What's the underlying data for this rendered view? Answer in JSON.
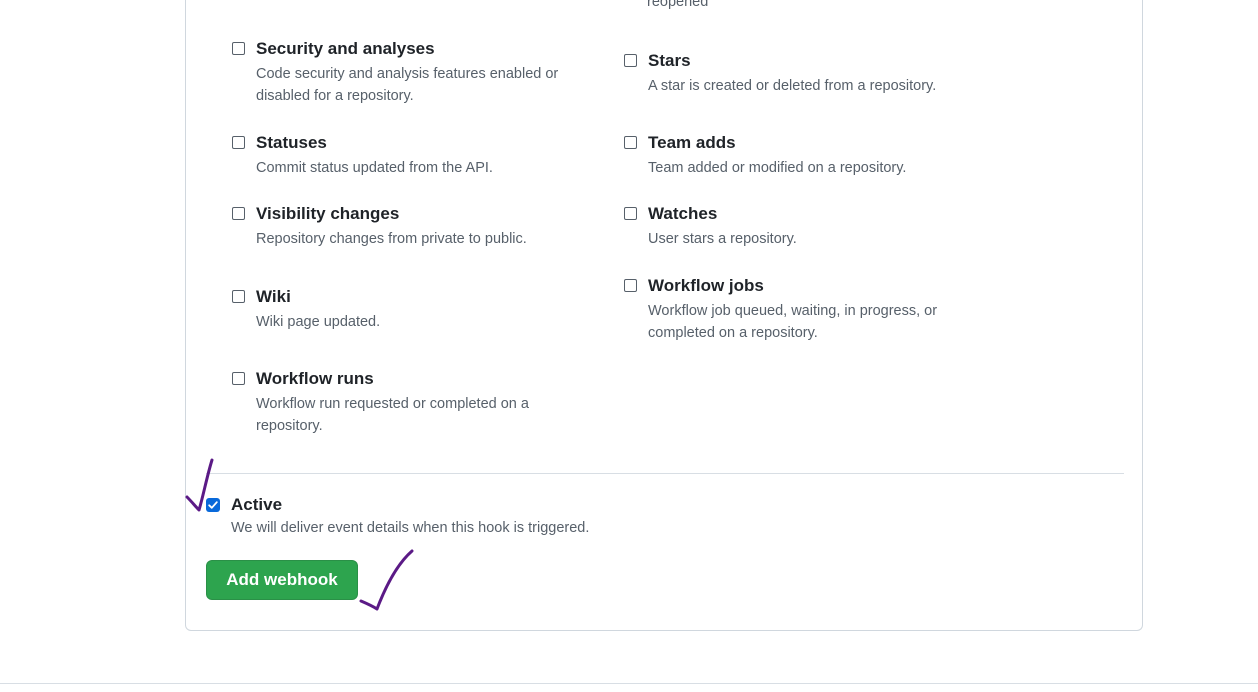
{
  "top_fragment": "reopened",
  "events_left": [
    {
      "title": "Security and analyses",
      "desc": "Code security and analysis features enabled or disabled for a repository.",
      "checked": false
    },
    {
      "title": "Statuses",
      "desc": "Commit status updated from the API.",
      "checked": false
    },
    {
      "title": "Visibility changes",
      "desc": "Repository changes from private to public.",
      "checked": false
    },
    {
      "title": "Wiki",
      "desc": "Wiki page updated.",
      "checked": false
    },
    {
      "title": "Workflow runs",
      "desc": "Workflow run requested or completed on a repository.",
      "checked": false
    }
  ],
  "events_right": [
    {
      "title": "Stars",
      "desc": "A star is created or deleted from a repository.",
      "checked": false
    },
    {
      "title": "Team adds",
      "desc": "Team added or modified on a repository.",
      "checked": false
    },
    {
      "title": "Watches",
      "desc": "User stars a repository.",
      "checked": false
    },
    {
      "title": "Workflow jobs",
      "desc": "Workflow job queued, waiting, in progress, or completed on a repository.",
      "checked": false
    }
  ],
  "active": {
    "title": "Active",
    "desc": "We will deliver event details when this hook is triggered.",
    "checked": true
  },
  "submit": {
    "label": "Add webhook"
  },
  "colors": {
    "primary_button": "#2da44e",
    "checkbox_checked": "#0969da",
    "annotation_ink": "#5b1a86"
  }
}
